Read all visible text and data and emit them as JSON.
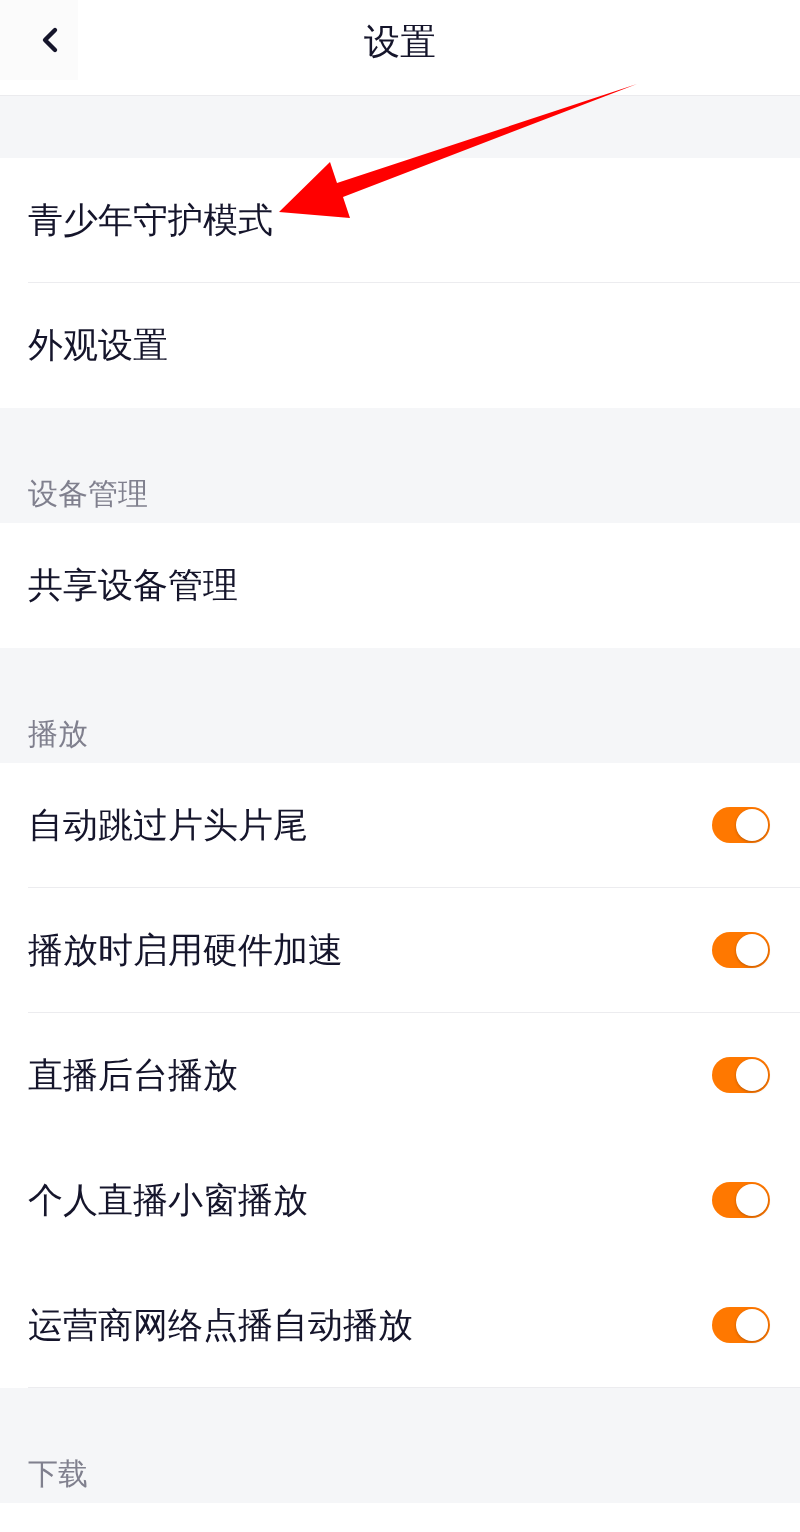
{
  "header": {
    "title": "设置"
  },
  "sections": [
    {
      "items": [
        {
          "kind": "link",
          "label": "青少年守护模式",
          "divider": true
        },
        {
          "kind": "link",
          "label": "外观设置",
          "divider": false
        }
      ]
    },
    {
      "title": "设备管理",
      "items": [
        {
          "kind": "link",
          "label": "共享设备管理",
          "divider": false
        }
      ]
    },
    {
      "title": "播放",
      "items": [
        {
          "kind": "toggle",
          "label": "自动跳过片头片尾",
          "on": true,
          "divider": true
        },
        {
          "kind": "toggle",
          "label": "播放时启用硬件加速",
          "on": true,
          "divider": true
        },
        {
          "kind": "toggle",
          "label": "直播后台播放",
          "on": true,
          "divider": false
        },
        {
          "kind": "toggle",
          "label": "个人直播小窗播放",
          "on": true,
          "divider": false
        },
        {
          "kind": "toggle",
          "label": "运营商网络点播自动播放",
          "on": true,
          "divider": true
        }
      ]
    },
    {
      "title": "下载"
    }
  ]
}
